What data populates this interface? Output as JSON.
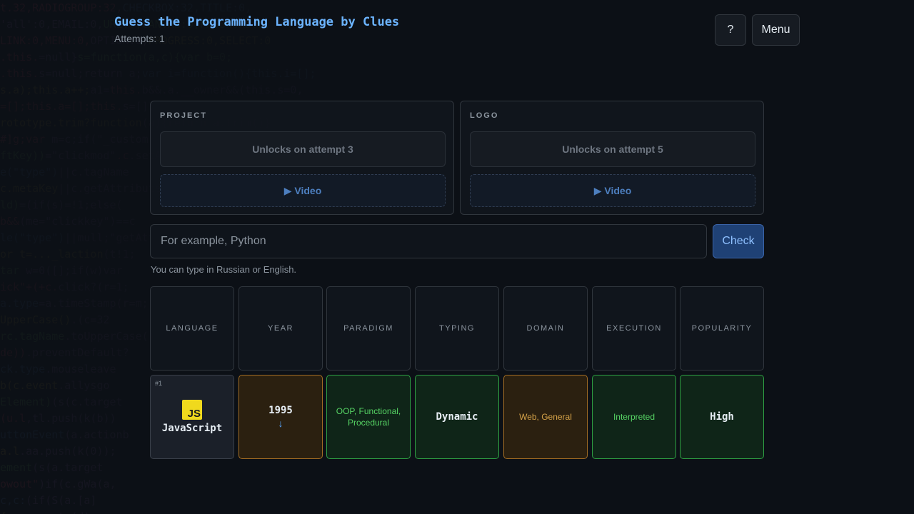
{
  "header": {
    "title": "Guess the Programming Language by Clues",
    "attempts": "Attempts: 1",
    "help_label": "?",
    "menu_label": "Menu"
  },
  "hints": [
    {
      "label": "PROJECT",
      "locked_text": "Unlocks on attempt 3",
      "video_label": "▶ Video"
    },
    {
      "label": "LOGO",
      "locked_text": "Unlocks on attempt 5",
      "video_label": "▶ Video"
    }
  ],
  "guess": {
    "placeholder": "For example, Python",
    "value": "",
    "check_label": "Check",
    "hint": "You can type in Russian or English."
  },
  "columns": [
    "LANGUAGE",
    "YEAR",
    "PARADIGM",
    "TYPING",
    "DOMAIN",
    "EXECUTION",
    "POPULARITY"
  ],
  "guesses": [
    {
      "number": "#1",
      "language": "JavaScript",
      "logo_text": "JS",
      "year": "1995",
      "year_arrow": "↓",
      "paradigm": "OOP, Functional, Procedural",
      "typing": "Dynamic",
      "domain": "Web, General",
      "execution": "Interpreted",
      "popularity": "High"
    }
  ],
  "colors": {
    "accent": "#6cb4ff",
    "match": "#2ea043",
    "partial": "#a36d23",
    "js_yellow": "#f0d91d"
  }
}
